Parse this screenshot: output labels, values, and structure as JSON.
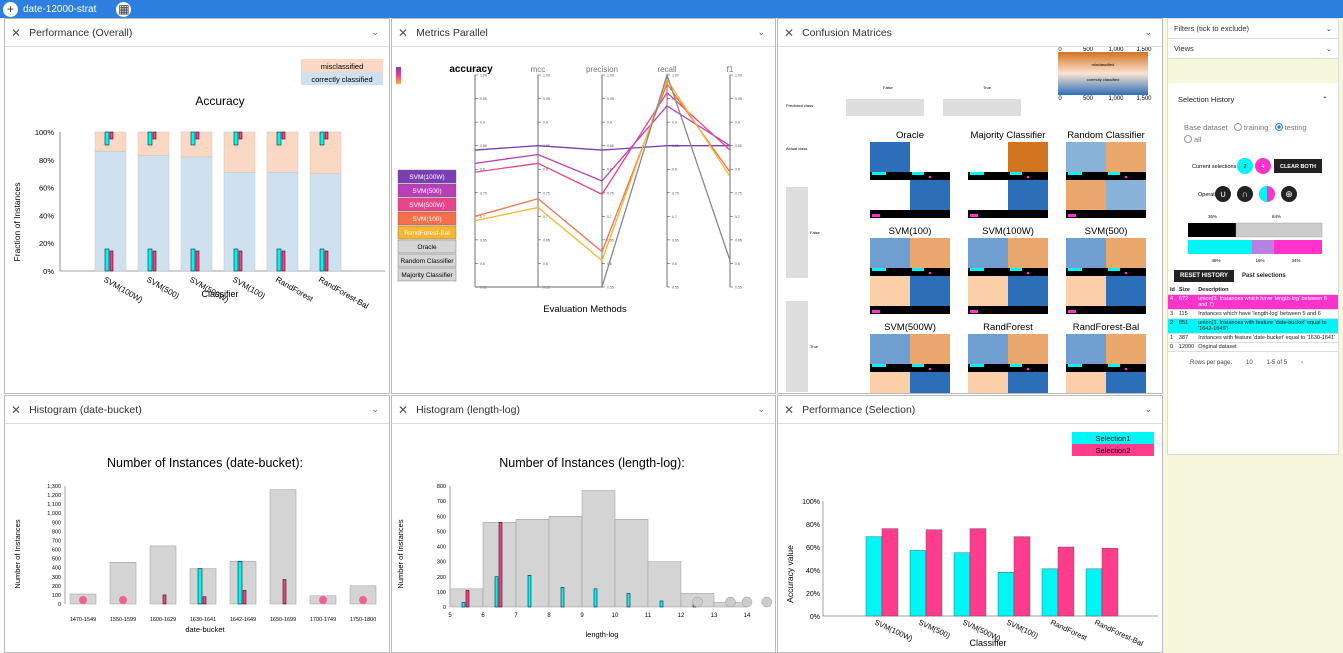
{
  "app": {
    "tab_title": "date-12000-strat",
    "add_icon": "plus-icon",
    "grid_icon": "grid-icon"
  },
  "panels": {
    "perf_overall": "Performance (Overall)",
    "metrics_parallel": "Metrics Parallel",
    "confusion": "Confusion Matrices",
    "hist_date": "Histogram (date-bucket)",
    "hist_length": "Histogram (length-log)",
    "perf_selection": "Performance (Selection)"
  },
  "perf_overall": {
    "title": "Accuracy",
    "ylabel": "Fraction of Instances",
    "xlabel": "Classifier",
    "legend": [
      "misclassified",
      "correctly classified"
    ],
    "yticks": [
      "0%",
      "20%",
      "40%",
      "60%",
      "80%",
      "100%"
    ],
    "classifiers": [
      "SVM(100W)",
      "SVM(500)",
      "SVM(500W)",
      "SVM(100)",
      "RandForest",
      "RandForest-Bal"
    ],
    "correct": [
      0.86,
      0.83,
      0.82,
      0.71,
      0.71,
      0.7
    ]
  },
  "metrics": {
    "axes": [
      "accuracy",
      "mcc",
      "precision",
      "recall",
      "f1"
    ],
    "xlabel": "Evaluation Methods",
    "legend": [
      "SVM(100W)",
      "SVM(500)",
      "SVM(500W)",
      "SVM(100)",
      "RandForest-Bal",
      "Oracle",
      "Random Classifier",
      "Majority Classifier"
    ],
    "legend_colors": [
      "#7b3fb3",
      "#b83fb8",
      "#e8458b",
      "#f66f4a",
      "#f5b731",
      "#d6d6d6",
      "#d6d6d6",
      "#d6d6d6"
    ],
    "ticks": [
      "0.55",
      "0.6",
      "0.65",
      "0.7",
      "0.75",
      "0.8",
      "0.85",
      "0.9",
      "0.95",
      "1.00"
    ]
  },
  "confusion": {
    "predicted_label": "Predicted class",
    "actual_label": "Actual class",
    "col_labels": [
      "False",
      "True"
    ],
    "row_labels": [
      "False",
      "True"
    ],
    "scale_ticks": [
      "0",
      "500",
      "1,000",
      "1,500"
    ],
    "scale_labels": [
      "misclassified",
      "correctly classified"
    ],
    "names": [
      "Oracle",
      "Majority Classifier",
      "Random Classifier",
      "SVM(100)",
      "SVM(100W)",
      "SVM(500)",
      "SVM(500W)",
      "RandForest",
      "RandForest-Bal"
    ]
  },
  "hist_date": {
    "title": "Number of Instances (date-bucket):",
    "ylabel": "Number of Instances",
    "xlabel": "date-bucket",
    "yticks": [
      "0",
      "100",
      "200",
      "300",
      "400",
      "500",
      "600",
      "700",
      "800",
      "900",
      "1,000",
      "1,100",
      "1,200",
      "1,300"
    ],
    "bins": [
      "1470-1549",
      "1550-1599",
      "1600-1629",
      "1630-1641",
      "1642-1649",
      "1650-1699",
      "1700-1749",
      "1750-1800"
    ],
    "counts": [
      110,
      460,
      640,
      390,
      470,
      1260,
      90,
      200
    ]
  },
  "hist_length": {
    "title": "Number of Instances (length-log):",
    "ylabel": "Number of Instances",
    "xlabel": "length-log",
    "yticks": [
      "0",
      "100",
      "200",
      "300",
      "400",
      "500",
      "600",
      "700",
      "800"
    ],
    "xticks": [
      "5",
      "6",
      "7",
      "8",
      "9",
      "10",
      "11",
      "12",
      "13",
      "14"
    ],
    "counts": [
      120,
      560,
      580,
      600,
      770,
      580,
      300,
      90,
      30,
      0
    ]
  },
  "perf_selection": {
    "ylabel": "Accuracy value",
    "xlabel": "Classifier",
    "legend": [
      "Selection1",
      "Selection2"
    ],
    "yticks": [
      "0%",
      "20%",
      "40%",
      "60%",
      "80%",
      "100%"
    ],
    "classifiers": [
      "SVM(100W)",
      "SVM(500)",
      "SVM(500W)",
      "SVM(100)",
      "RandForest",
      "RandForest-Bal"
    ],
    "sel1": [
      0.69,
      0.57,
      0.55,
      0.38,
      0.41,
      0.41
    ],
    "sel2": [
      0.76,
      0.75,
      0.76,
      0.69,
      0.6,
      0.59
    ]
  },
  "sidebar": {
    "filters": "Filters (tick to exclude)",
    "views": "Views",
    "history": "Selection History",
    "base_dataset": "Base dataset",
    "opt_training": "training",
    "opt_testing": "testing",
    "opt_all": "all",
    "current_selections": "Current selections",
    "sel_a": "2",
    "sel_b": "4",
    "clear_both": "CLEAR BOTH",
    "operations": "Operations",
    "bar1_left": "36%",
    "bar1_right": "64%",
    "bar2": [
      "46%",
      "16%",
      "34%"
    ],
    "reset": "RESET HISTORY",
    "past": "Past selections",
    "cols": [
      "Id",
      "Size",
      "Description"
    ],
    "rows": [
      {
        "id": "4",
        "size": "672",
        "desc": "union(3, Instances which have 'length-log' between 6 and 7)"
      },
      {
        "id": "3",
        "size": "115",
        "desc": "Instances which have 'length-log' between 5 and 6"
      },
      {
        "id": "2",
        "size": "851",
        "desc": "union(1, Instances with feature 'date-bucket' equal to '1642-1649')"
      },
      {
        "id": "1",
        "size": "387",
        "desc": "Instances with feature 'date-bucket' equal to '1630-1641'"
      },
      {
        "id": "0",
        "size": "12000",
        "desc": "Original dataset"
      }
    ],
    "rows_per_page": "Rows per page:",
    "rpp_value": "10",
    "range": "1-5 of 5"
  },
  "colors": {
    "accent": "#2d7fe0",
    "cyan": "#00f5f5",
    "pink": "#ff3d8c",
    "magenta": "#ff33cc",
    "correct": "#cfe1ee",
    "miscls": "#fbd8c4"
  }
}
